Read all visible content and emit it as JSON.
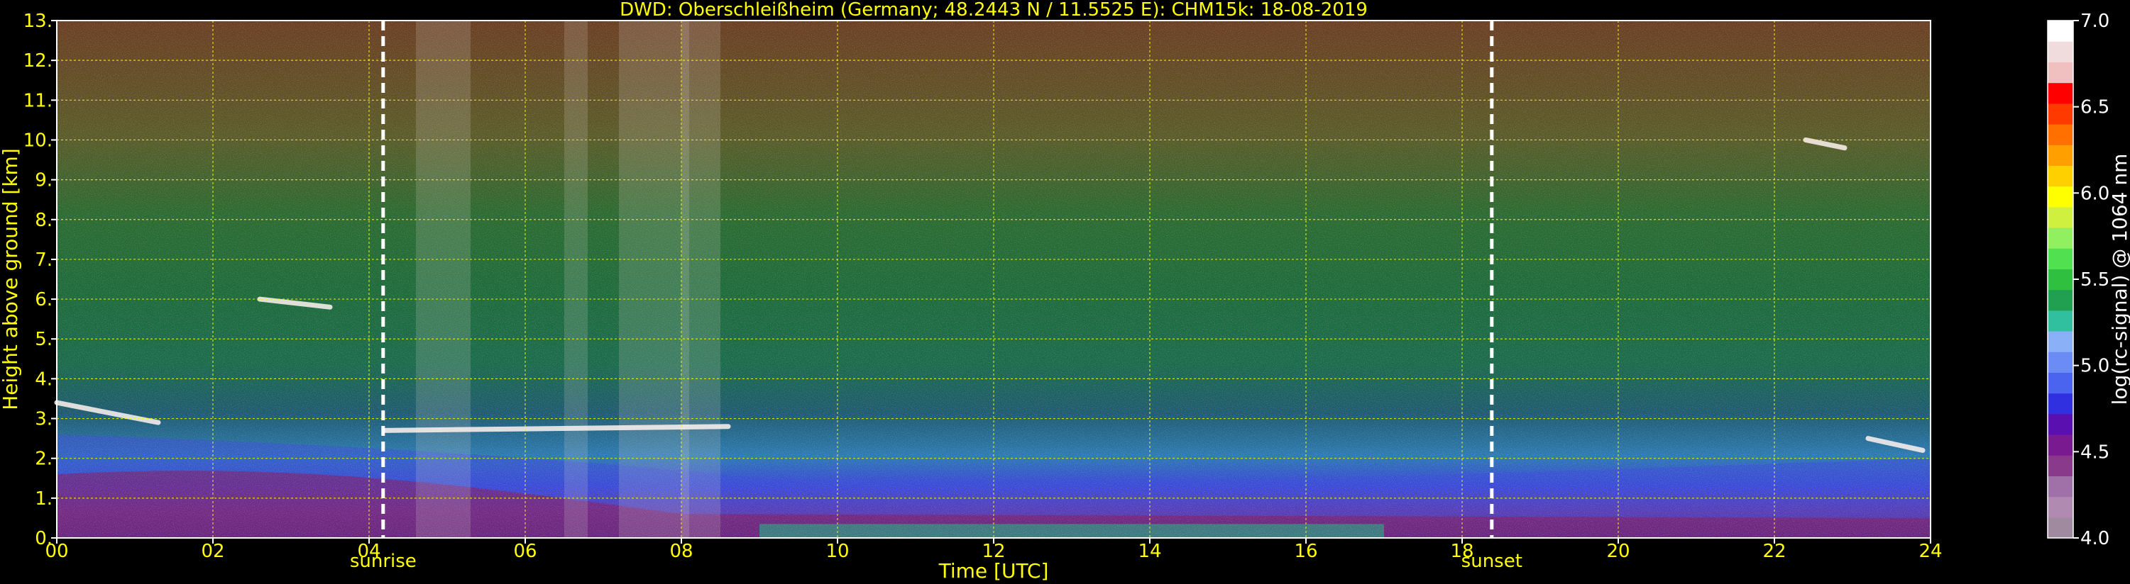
{
  "chart_data": {
    "type": "heatmap",
    "title": "DWD: Oberschleißheim (Germany; 48.2443 N / 11.5525 E):    CHM15k: 18-08-2019",
    "xlabel": "Time [UTC]",
    "ylabel": "Height above ground [km]",
    "xlim": [
      0,
      24
    ],
    "ylim": [
      0,
      13
    ],
    "x_ticks": [
      "00",
      "02",
      "04",
      "06",
      "08",
      "10",
      "12",
      "14",
      "16",
      "18",
      "20",
      "22",
      "24"
    ],
    "y_ticks": [
      "0.",
      "1.",
      "2.",
      "3.",
      "4.",
      "5.",
      "6.",
      "7.",
      "8.",
      "9.",
      "10.",
      "11.",
      "12.",
      "13."
    ],
    "grid": true,
    "grid_color": "#ffff00",
    "background_color": "#000000",
    "text_color": "#ffff00",
    "markers": [
      {
        "label": "sunrise",
        "x": 4.18
      },
      {
        "label": "sunset",
        "x": 18.38
      }
    ],
    "colorbar": {
      "label": "log(rc-signal) @ 1064 nm",
      "range": [
        4.0,
        7.0
      ],
      "ticks": [
        "4.0",
        "4.5",
        "5.0",
        "5.5",
        "6.0",
        "6.5",
        "7.0"
      ],
      "colors": [
        "#a08aa0",
        "#b08ab0",
        "#a070a8",
        "#8a3a8a",
        "#7a1a90",
        "#5a10b0",
        "#3030e0",
        "#4a64f0",
        "#6a8cf4",
        "#8ab0f8",
        "#30c0a0",
        "#20a050",
        "#30c040",
        "#50e050",
        "#90f060",
        "#d0f040",
        "#ffff00",
        "#ffd000",
        "#ffa000",
        "#ff7000",
        "#ff3a00",
        "#ff0000",
        "#f0c0c0",
        "#f0dcdc",
        "#ffffff"
      ]
    }
  }
}
